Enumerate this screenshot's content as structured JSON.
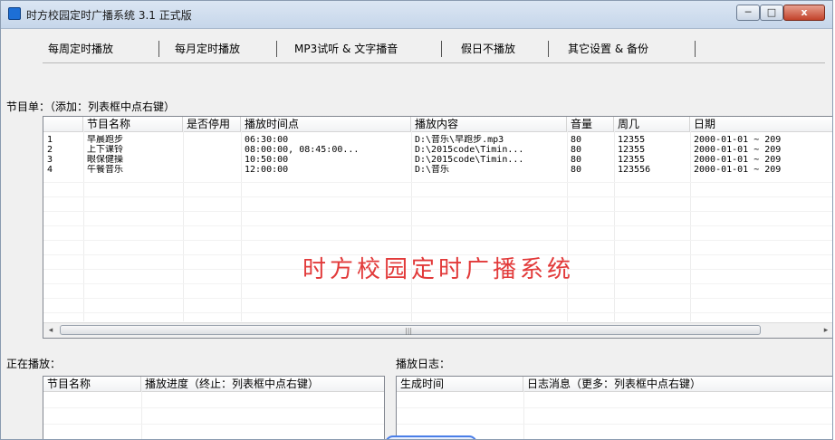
{
  "window": {
    "title": "时方校园定时广播系统 3.1 正式版",
    "minimize": "─",
    "maximize": "□",
    "close": "x"
  },
  "tabs": [
    "每周定时播放",
    "每月定时播放",
    "MP3试听 & 文字播音",
    "假日不播放",
    "其它设置 & 备份"
  ],
  "program_list": {
    "label": "节目单：（添加：列表框中点右键）",
    "columns": [
      "节目名称",
      "是否停用",
      "播放时间点",
      "播放内容",
      "音量",
      "周几",
      "日期"
    ],
    "rows": [
      {
        "num": "1",
        "name": "早晨跑步",
        "disabled": "",
        "time": "06:30:00",
        "content": "D:\\音乐\\早跑步.mp3",
        "volume": "80",
        "weekdays": "12355",
        "date": "2000-01-01 ~ 209"
      },
      {
        "num": "2",
        "name": "上下课铃",
        "disabled": "",
        "time": "08:00:00, 08:45:00...",
        "content": "D:\\2015code\\Timin...",
        "volume": "80",
        "weekdays": "12355",
        "date": "2000-01-01 ~ 209"
      },
      {
        "num": "3",
        "name": "眼保健操",
        "disabled": "",
        "time": "10:50:00",
        "content": "D:\\2015code\\Timin...",
        "volume": "80",
        "weekdays": "12355",
        "date": "2000-01-01 ~ 209"
      },
      {
        "num": "4",
        "name": "午餐音乐",
        "disabled": "",
        "time": "12:00:00",
        "content": "D:\\音乐",
        "volume": "80",
        "weekdays": "123556",
        "date": "2000-01-01 ~ 209"
      }
    ],
    "watermark": "时方校园定时广播系统",
    "scroll": {
      "left": "◂",
      "right": "▸",
      "grip": "|||"
    }
  },
  "now_playing": {
    "label": "正在播放：",
    "columns": [
      "节目名称",
      "播放进度（终止：列表框中点右键）"
    ]
  },
  "play_log": {
    "label": "播放日志：",
    "columns": [
      "生成时间",
      "日志消息（更多：列表框中点右键）"
    ]
  },
  "colors": {
    "watermark": "#e23a3a",
    "title_bar": "#c6d6ea",
    "window_bg": "#f0f0f0"
  }
}
